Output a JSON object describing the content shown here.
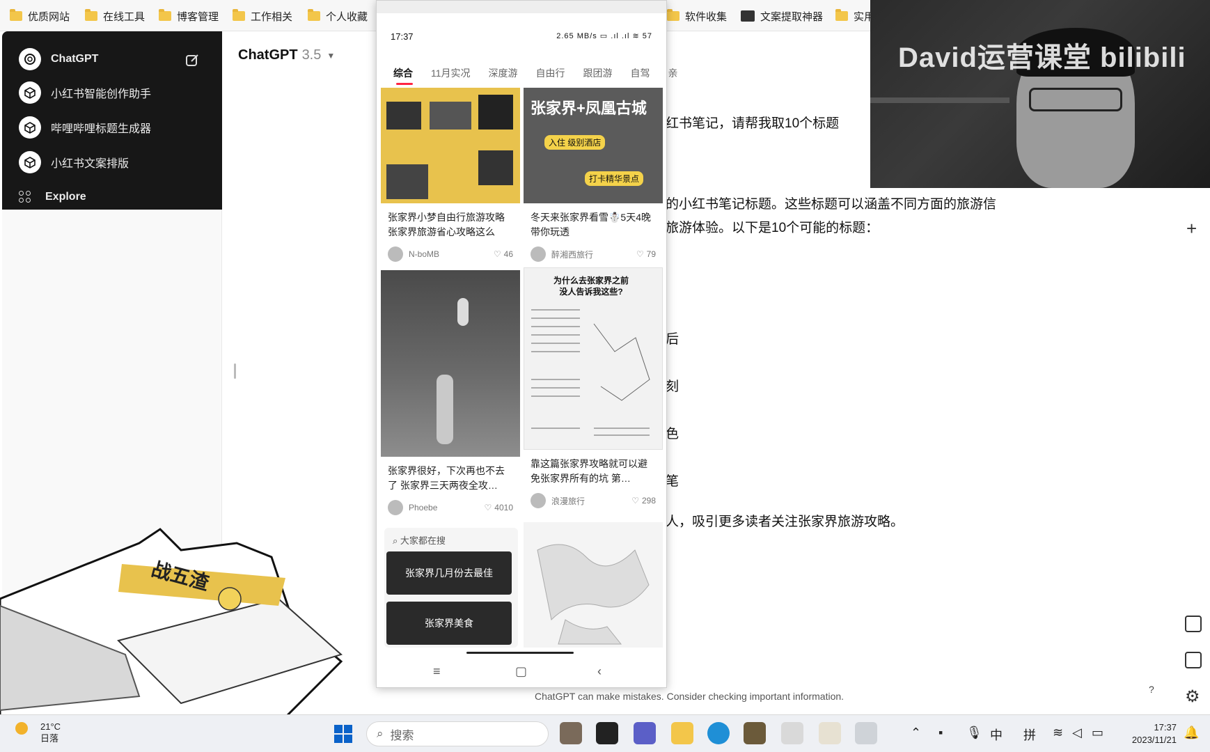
{
  "bookmarks": [
    {
      "label": "优质网站",
      "icon": "folder-icon"
    },
    {
      "label": "在线工具",
      "icon": "folder-icon"
    },
    {
      "label": "博客管理",
      "icon": "folder-icon"
    },
    {
      "label": "工作相关",
      "icon": "folder-icon"
    },
    {
      "label": "个人收藏",
      "icon": "folder-icon"
    },
    {
      "label": "软件收集",
      "icon": "folder-icon"
    },
    {
      "label": "文案提取神器",
      "icon": "app-icon"
    },
    {
      "label": "实用",
      "icon": "folder-icon"
    }
  ],
  "sidebar": {
    "items": [
      {
        "label": "ChatGPT"
      },
      {
        "label": "小红书智能创作助手"
      },
      {
        "label": "哔哩哔哩标题生成器"
      },
      {
        "label": "小红书文案排版"
      },
      {
        "label": "Explore"
      }
    ]
  },
  "main": {
    "model_name": "ChatGPT",
    "model_version": "3.5",
    "lines": [
      "红书笔记，请帮我取10个标题",
      "的小红书笔记标题。这些标题可以涵盖不同方面的旅游信",
      "旅游体验。以下是10个可能的标题：",
      "后",
      "刻",
      "色",
      "笔",
      "人，吸引更多读者关注张家界旅游攻略。"
    ],
    "disclaimer": "ChatGPT can make mistakes. Consider checking important information."
  },
  "phone": {
    "time": "17:37",
    "status_right": "2.65 MB/s  ▭ .ıl .ıl ≋ 57",
    "tabs": [
      "综合",
      "11月实况",
      "深度游",
      "自由行",
      "跟团游",
      "自驾",
      "亲"
    ],
    "cards": [
      {
        "title": "张家界小梦自由行旅游攻略 张家界旅游省心攻略这么",
        "author": "N-boMB",
        "likes": "46"
      },
      {
        "title": "冬天来张家界看雪☃️5天4晚带你玩透",
        "author": "醉湘西旅行",
        "likes": "79"
      },
      {
        "title": "张家界很好，下次再也不去了 张家界三天两夜全攻…",
        "author": "Phoebe",
        "likes": "4010"
      },
      {
        "title": "靠这篇张家界攻略就可以避免张家界所有的坑 第…",
        "author": "浪漫旅行",
        "likes": "298"
      }
    ],
    "card2_banner": "张家界+凤凰古城",
    "card2_tag1": "入住 级别酒店",
    "card2_tag2": "打卡精华景点",
    "card4_heading": "为什么去张家界之前 没人告诉我这些?",
    "search_heading": "大家都在搜",
    "suggestions": [
      "张家界几月份去最佳",
      "张家界美食"
    ]
  },
  "webcam": {
    "overlay_text": "David运营课堂 bilibili"
  },
  "cat": {
    "headband_text": "战五渣"
  },
  "taskbar": {
    "temperature": "21°C",
    "weather": "日落",
    "search_placeholder": "搜索",
    "ime1": "中",
    "ime2": "拼",
    "time": "17:37",
    "date": "2023/11/21"
  }
}
